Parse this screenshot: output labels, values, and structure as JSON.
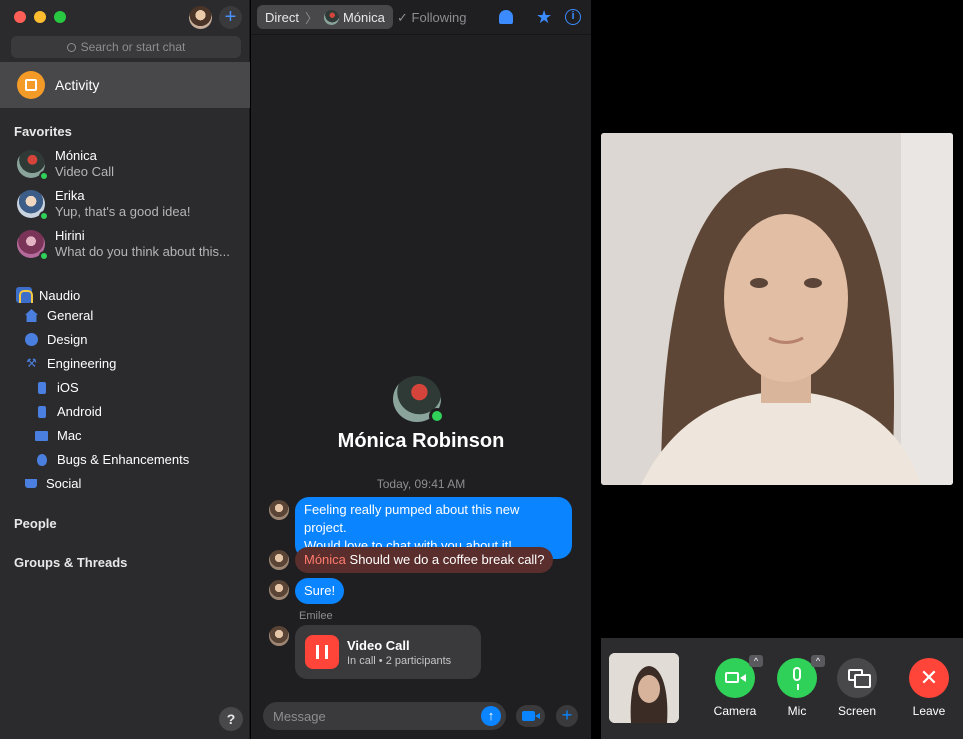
{
  "window": {
    "traffic_lights": [
      "close",
      "minimize",
      "zoom"
    ]
  },
  "sidebar": {
    "new_chat_icon": "+",
    "search_placeholder": "Search or start chat",
    "activity_label": "Activity",
    "favorites_header": "Favorites",
    "favorites": [
      {
        "name": "Mónica",
        "subtitle": "Video Call",
        "online": true
      },
      {
        "name": "Erika",
        "subtitle": "Yup, that's a good idea!",
        "online": true
      },
      {
        "name": "Hirini",
        "subtitle": "What do you think about this...",
        "online": true
      }
    ],
    "workspace": {
      "name": "Naudio",
      "channels": [
        {
          "label": "General",
          "icon": "home-icon"
        },
        {
          "label": "Design",
          "icon": "palette-icon"
        },
        {
          "label": "Engineering",
          "icon": "hammer-icon"
        },
        {
          "label": "iOS",
          "icon": "phone-icon"
        },
        {
          "label": "Android",
          "icon": "phone-icon"
        },
        {
          "label": "Mac",
          "icon": "desktop-icon"
        },
        {
          "label": "Bugs & Enhancements",
          "icon": "bug-icon"
        },
        {
          "label": "Social",
          "icon": "cup-icon"
        }
      ]
    },
    "people_header": "People",
    "groups_header": "Groups & Threads",
    "help_icon": "?"
  },
  "chat": {
    "header": {
      "crumb_root": "Direct",
      "crumb_separator": "〉",
      "crumb_contact": "Mónica",
      "following_check": "✓",
      "following_label": "Following",
      "star_icon": "★",
      "info_icon": "i"
    },
    "profile_name": "Mónica Robinson",
    "timestamp": "Today, 09:41 AM",
    "messages": [
      {
        "text_line1": "Feeling really pumped about this new project.",
        "text_line2": "Would love to chat with you about it!"
      },
      {
        "mention": "Mónica",
        "text": " Should we do a coffee break call?"
      },
      {
        "text": "Sure!"
      }
    ],
    "sender_label": "Emilee",
    "video_call_card": {
      "title": "Video Call",
      "subtitle": "In call • 2 participants"
    },
    "composer": {
      "placeholder": "Message",
      "send_icon": "↑",
      "attach_icon": "+"
    }
  },
  "call": {
    "controls": [
      {
        "label": "Camera",
        "state": "on",
        "color": "#30d158"
      },
      {
        "label": "Mic",
        "state": "on",
        "color": "#30d158"
      },
      {
        "label": "Screen",
        "state": "off",
        "color": "#48484a"
      },
      {
        "label": "Leave",
        "color": "#ff453a"
      }
    ],
    "caret_icon": "^",
    "leave_icon": "✕"
  },
  "colors": {
    "accent": "#0a84ff",
    "online": "#30d158",
    "activity": "#f39a27",
    "danger": "#ff453a"
  }
}
